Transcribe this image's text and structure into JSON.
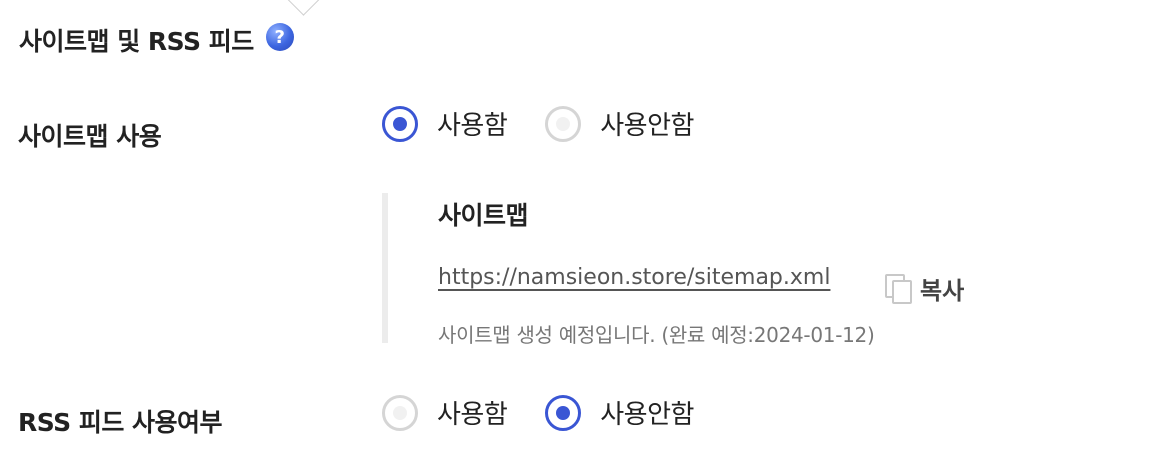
{
  "section": {
    "title": "사이트맵 및 RSS 피드",
    "help_icon_glyph": "?",
    "help_color": "#3d66e0"
  },
  "sitemap_usage": {
    "label": "사이트맵 사용",
    "options": [
      {
        "label": "사용함",
        "selected": true
      },
      {
        "label": "사용안함",
        "selected": false
      }
    ]
  },
  "sitemap_detail": {
    "title": "사이트맵",
    "url": "https://namsieon.store/sitemap.xml",
    "copy_label": "복사",
    "copy_icon": "copy-icon",
    "status": "사이트맵 생성 예정입니다. (완료 예정:2024-01-12)"
  },
  "rss_usage": {
    "label": "RSS 피드 사용여부",
    "options": [
      {
        "label": "사용함",
        "selected": false
      },
      {
        "label": "사용안함",
        "selected": true
      }
    ]
  },
  "colors": {
    "accent": "#3a56d4",
    "radio_off": "#d5d5d5"
  }
}
